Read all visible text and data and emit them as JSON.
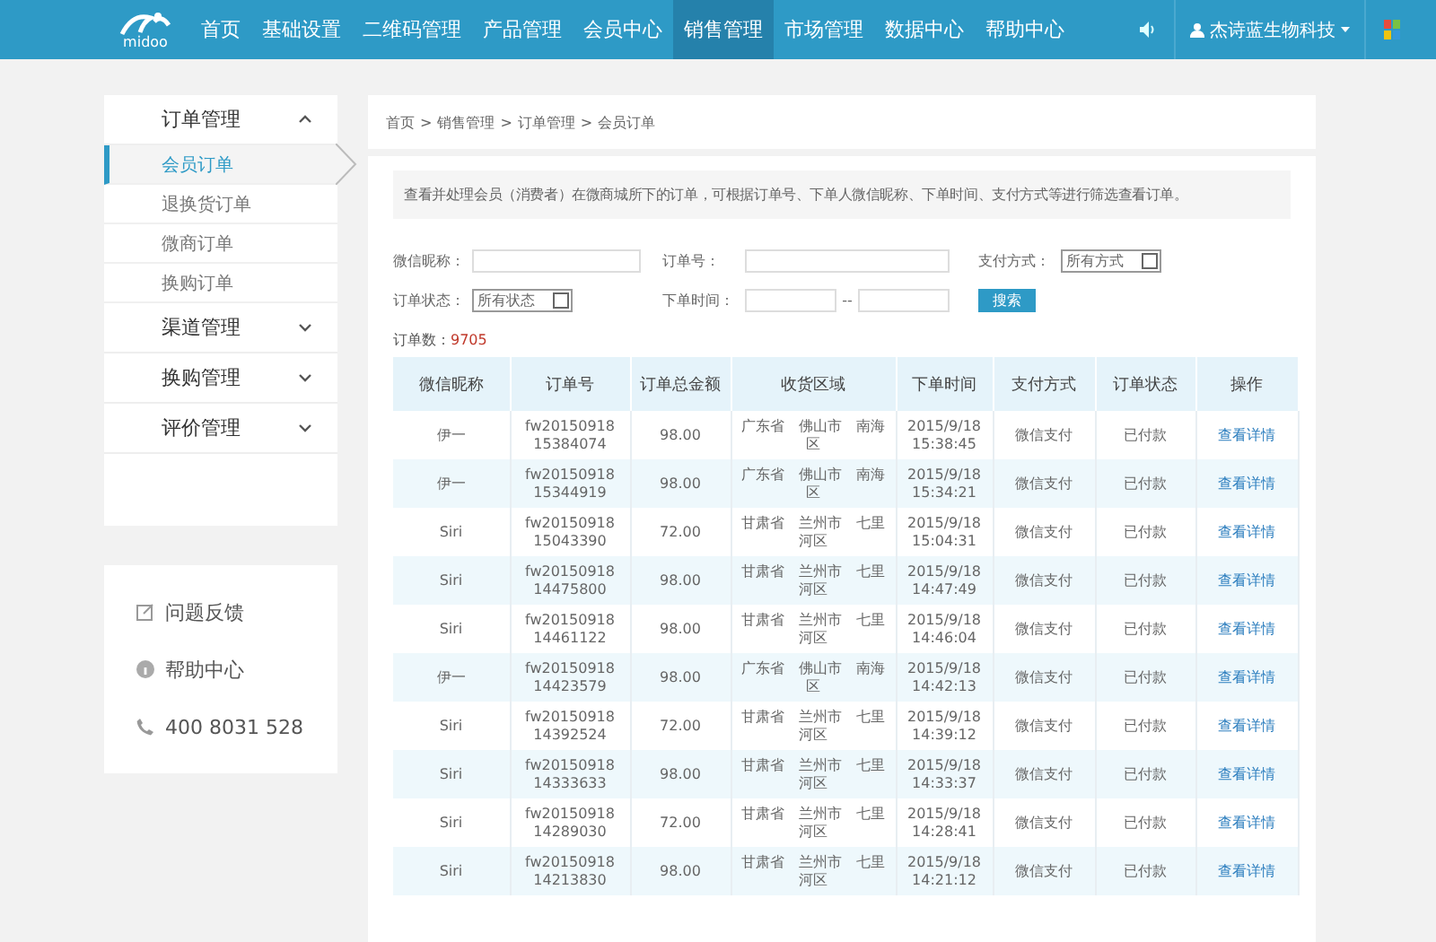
{
  "header": {
    "logo": "midoo",
    "nav": [
      {
        "label": "首页",
        "selected": false
      },
      {
        "label": "基础设置",
        "selected": false
      },
      {
        "label": "二维码管理",
        "selected": false
      },
      {
        "label": "产品管理",
        "selected": false
      },
      {
        "label": "会员中心",
        "selected": false
      },
      {
        "label": "销售管理",
        "selected": true
      },
      {
        "label": "市场管理",
        "selected": false
      },
      {
        "label": "数据中心",
        "selected": false
      },
      {
        "label": "帮助中心",
        "selected": false
      }
    ],
    "user": "杰诗蓝生物科技"
  },
  "sidebar": {
    "groups": [
      {
        "label": "订单管理",
        "expanded": true,
        "children": [
          {
            "label": "会员订单",
            "selected": true
          },
          {
            "label": "退换货订单",
            "selected": false
          },
          {
            "label": "微商订单",
            "selected": false
          },
          {
            "label": "换购订单",
            "selected": false
          }
        ]
      },
      {
        "label": "渠道管理",
        "expanded": false
      },
      {
        "label": "换购管理",
        "expanded": false
      },
      {
        "label": "评价管理",
        "expanded": false
      }
    ],
    "support": [
      {
        "kind": "feedback",
        "label": "问题反馈"
      },
      {
        "kind": "help",
        "label": "帮助中心"
      },
      {
        "kind": "phone",
        "label": "400 8031 528"
      }
    ]
  },
  "breadcrumb": [
    "首页",
    "销售管理",
    "订单管理",
    "会员订单"
  ],
  "breadcrumb_separator": ">",
  "notice": "查看并处理会员（消费者）在微商城所下的订单，可根据订单号、下单人微信昵称、下单时间、支付方式等进行筛选查看订单。",
  "filters": {
    "nickname_label": "微信昵称：",
    "order_no_label": "订单号：",
    "payment_label": "支付方式：",
    "payment_value": "所有方式",
    "status_label": "订单状态：",
    "status_value": "所有状态",
    "time_label": "下单时间：",
    "time_separator": "--",
    "search_button": "搜索"
  },
  "order_count": {
    "label": "订单数：",
    "value": "9705"
  },
  "table": {
    "columns": [
      "微信昵称",
      "订单号",
      "订单总金额",
      "收货区域",
      "下单时间",
      "支付方式",
      "订单状态",
      "操作"
    ],
    "rows": [
      [
        "伊一",
        "fw20150918 15384074",
        "98.00",
        "广东省　佛山市　南海区",
        "2015/9/18 15:38:45",
        "微信支付",
        "已付款",
        "查看详情"
      ],
      [
        "伊一",
        "fw20150918 15344919",
        "98.00",
        "广东省　佛山市　南海区",
        "2015/9/18 15:34:21",
        "微信支付",
        "已付款",
        "查看详情"
      ],
      [
        "Siri",
        "fw20150918 15043390",
        "72.00",
        "甘肃省　兰州市　七里河区",
        "2015/9/18 15:04:31",
        "微信支付",
        "已付款",
        "查看详情"
      ],
      [
        "Siri",
        "fw20150918 14475800",
        "98.00",
        "甘肃省　兰州市　七里河区",
        "2015/9/18 14:47:49",
        "微信支付",
        "已付款",
        "查看详情"
      ],
      [
        "Siri",
        "fw20150918 14461122",
        "98.00",
        "甘肃省　兰州市　七里河区",
        "2015/9/18 14:46:04",
        "微信支付",
        "已付款",
        "查看详情"
      ],
      [
        "伊一",
        "fw20150918 14423579",
        "98.00",
        "广东省　佛山市　南海区",
        "2015/9/18 14:42:13",
        "微信支付",
        "已付款",
        "查看详情"
      ],
      [
        "Siri",
        "fw20150918 14392524",
        "72.00",
        "甘肃省　兰州市　七里河区",
        "2015/9/18 14:39:12",
        "微信支付",
        "已付款",
        "查看详情"
      ],
      [
        "Siri",
        "fw20150918 14333633",
        "98.00",
        "甘肃省　兰州市　七里河区",
        "2015/9/18 14:33:37",
        "微信支付",
        "已付款",
        "查看详情"
      ],
      [
        "Siri",
        "fw20150918 14289030",
        "72.00",
        "甘肃省　兰州市　七里河区",
        "2015/9/18 14:28:41",
        "微信支付",
        "已付款",
        "查看详情"
      ],
      [
        "Siri",
        "fw20150918 14213830",
        "98.00",
        "甘肃省　兰州市　七里河区",
        "2015/9/18 14:21:12",
        "微信支付",
        "已付款",
        "查看详情"
      ]
    ]
  }
}
